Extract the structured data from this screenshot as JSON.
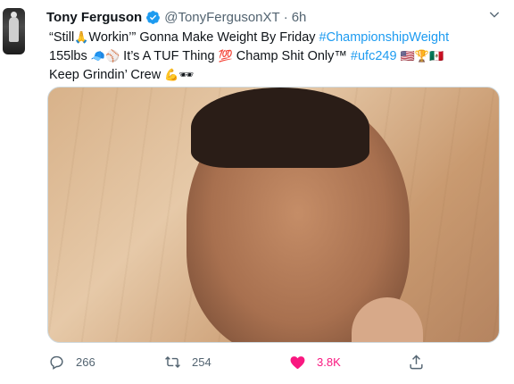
{
  "author": {
    "name": "Tony Ferguson",
    "handle": "@TonyFergusonXT",
    "separator": "·",
    "time": "6h"
  },
  "tweet": {
    "line1": [
      "“Still",
      "🙏",
      "Workin’” Gonna Make Weight By Friday ",
      "#ChampionshipWeight"
    ],
    "line2": [
      "155lbs ",
      "🧢",
      "⚾",
      " It’s A TUF Thing ",
      "💯",
      " Champ Shit Only",
      "™",
      " ",
      "#ufc249",
      " ",
      "🇺🇸",
      "🏆",
      "🇲🇽"
    ],
    "line3": [
      "Keep Grindin’ Crew ",
      "💪",
      "🕶"
    ]
  },
  "actions": {
    "reply_count": "266",
    "retweet_count": "254",
    "like_count": "3.8K"
  },
  "colors": {
    "link": "#1d9bf0",
    "like": "#f91880",
    "muted": "#536471"
  },
  "icons": [
    "verified-badge-icon",
    "caret-down-icon",
    "reply-icon",
    "retweet-icon",
    "heart-icon",
    "share-icon"
  ]
}
